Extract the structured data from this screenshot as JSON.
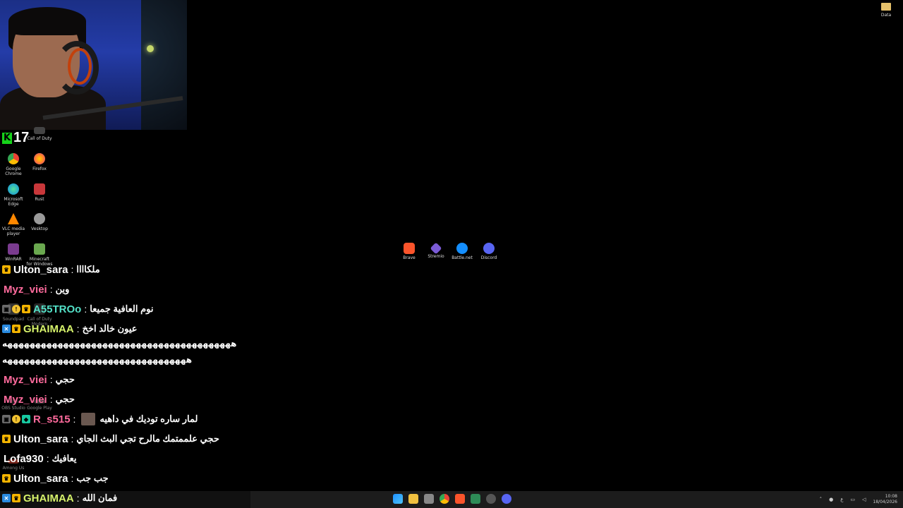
{
  "kick": {
    "logo": "K",
    "viewer_count": "17"
  },
  "desktop_icons": [
    {
      "label": "Call of Duty",
      "color": "#444"
    },
    {
      "label": "Google Chrome",
      "color": "#34a853"
    },
    {
      "label": "Firefox",
      "color": "#ff7139"
    },
    {
      "label": "Microsoft Edge",
      "color": "#0e8be2"
    },
    {
      "label": "Rust",
      "color": "#c8373a"
    },
    {
      "label": "VLC media player",
      "color": "#ff8800"
    },
    {
      "label": "Vesktop",
      "color": "#9a9a9a"
    },
    {
      "label": "WinRAR",
      "color": "#7a3b8f"
    },
    {
      "label": "Minecraft for Windows",
      "color": "#6aa84f"
    },
    {
      "label": "Soundpad",
      "color": "#555"
    },
    {
      "label": "Call of Duty Modern",
      "color": "#444"
    },
    {
      "label": "OBS Studio",
      "color": "#333"
    },
    {
      "label": "Google Play",
      "color": "#555"
    },
    {
      "label": "Among Us",
      "color": "#c0392b"
    }
  ],
  "data_folder": {
    "label": "Data"
  },
  "dock_icons": [
    {
      "label": "Brave",
      "color": "#fb542b"
    },
    {
      "label": "Stremio",
      "color": "#7b5bd6"
    },
    {
      "label": "Battle.net",
      "color": "#148eff"
    },
    {
      "label": "Discord",
      "color": "#5865f2"
    }
  ],
  "chat": [
    {
      "badges": [
        "crown"
      ],
      "user": "Ulton_sara",
      "color": "#ffffff",
      "sep": ":",
      "msg": "ملكاااا"
    },
    {
      "badges": [],
      "user": "Myz_viei",
      "color": "#ff6b9d",
      "sep": ":",
      "msg": "وين"
    },
    {
      "badges": [
        "gift",
        "excl",
        "crown"
      ],
      "user": "A55TROo",
      "color": "#53e0c7",
      "sep": ":",
      "msg": "نوم العافية جميعا"
    },
    {
      "badges": [
        "mod",
        "crown"
      ],
      "user": "GHAIMAA",
      "color": "#d6f26b",
      "sep": ":",
      "msg": "عيون خالد اخخ"
    },
    {
      "badges": [],
      "user": "Myz_viei",
      "color": "#ff6b9d",
      "sep": ":",
      "msg": "حجي"
    },
    {
      "badges": [],
      "user": "Myz_viei",
      "color": "#ff6b9d",
      "sep": ":",
      "msg": "حجي"
    },
    {
      "badges": [
        "gift",
        "excl",
        "green"
      ],
      "user": "R_s515",
      "color": "#ff6b9d",
      "sep": ":",
      "msg": "لمار ساره توديك في داهيه"
    },
    {
      "badges": [
        "crown"
      ],
      "user": "Ulton_sara",
      "color": "#ffffff",
      "sep": ":",
      "msg": "حجي علممتمك مالرح تجي البث الجاي"
    },
    {
      "badges": [],
      "user": "Lofa930",
      "color": "#ffffff",
      "sep": ":",
      "msg": "يعافيك"
    },
    {
      "badges": [
        "crown"
      ],
      "user": "Ulton_sara",
      "color": "#ffffff",
      "sep": ":",
      "msg": "جب جب"
    },
    {
      "badges": [
        "mod",
        "crown"
      ],
      "user": "GHAIMAA",
      "color": "#d6f26b",
      "sep": ":",
      "msg": "فمان الله"
    }
  ],
  "spam_lines": [
    "هههههههههههههههههههههههههههههههههههههههههه",
    "هههههههههههههههههههههههههههههههههه"
  ],
  "tray": {
    "lang": "ع",
    "time": "10:08",
    "date": "18/04/2026"
  }
}
